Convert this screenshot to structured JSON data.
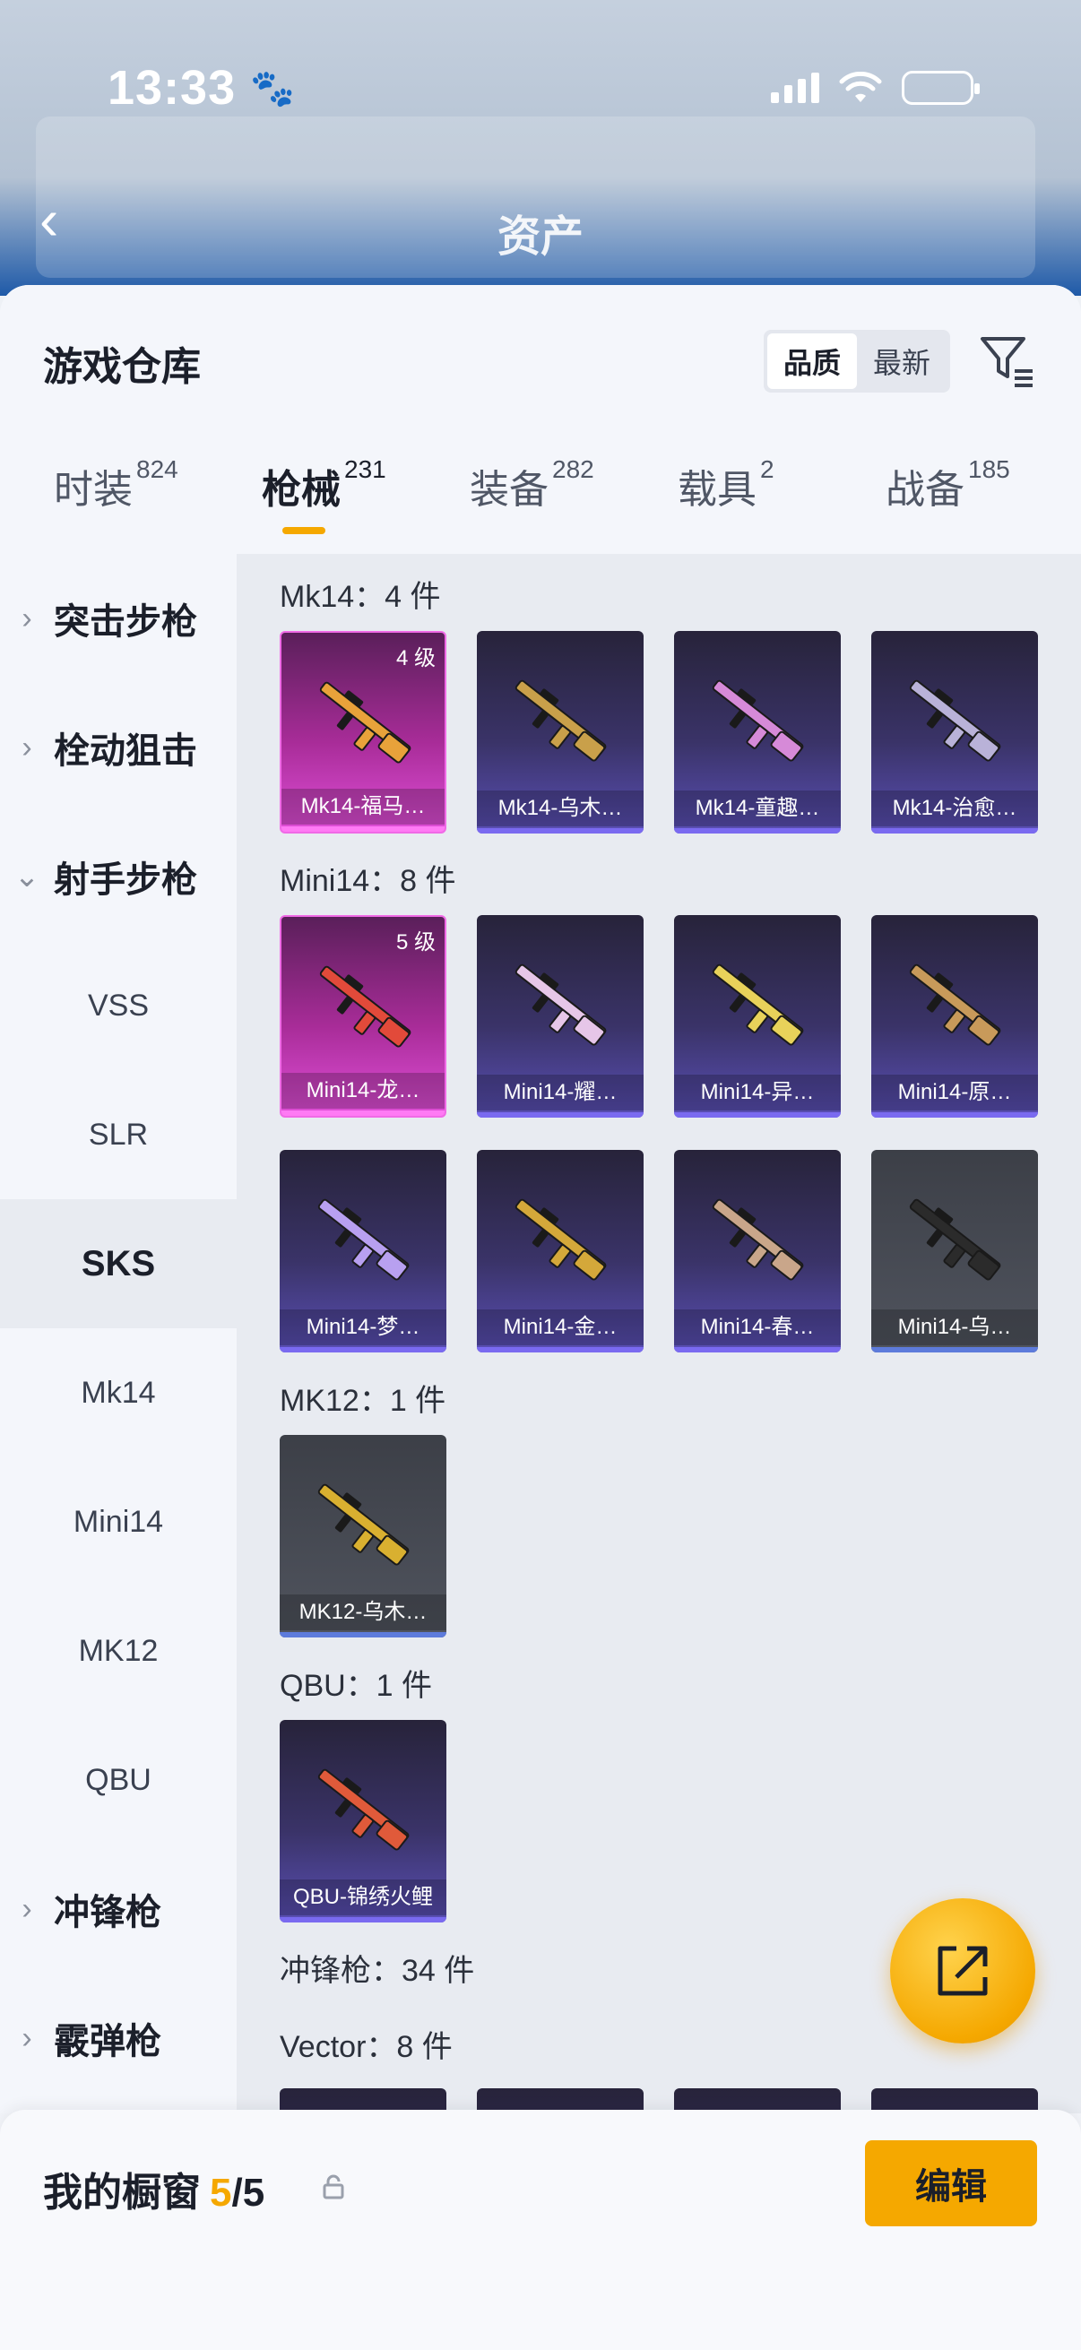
{
  "status_bar": {
    "time": "13:33"
  },
  "background": {
    "title": "资产"
  },
  "header": {
    "title": "游戏仓库",
    "sort_options": [
      "品质",
      "最新"
    ],
    "active_sort": 0
  },
  "tabs": [
    {
      "label": "时装",
      "count": "824"
    },
    {
      "label": "枪械",
      "count": "231"
    },
    {
      "label": "装备",
      "count": "282"
    },
    {
      "label": "载具",
      "count": "2"
    },
    {
      "label": "战备",
      "count": "185"
    }
  ],
  "sidebar": {
    "categories": [
      {
        "label": "突击步枪",
        "expanded": false
      },
      {
        "label": "栓动狙击",
        "expanded": false
      },
      {
        "label": "射手步枪",
        "expanded": true
      },
      {
        "label": "冲锋枪",
        "expanded": false
      },
      {
        "label": "霰弹枪",
        "expanded": false
      }
    ],
    "subcategories": [
      "VSS",
      "SLR",
      "SKS",
      "Mk14",
      "Mini14",
      "MK12",
      "QBU"
    ],
    "selected_sub": "SKS"
  },
  "groups": [
    {
      "title": "Mk14：4 件",
      "items": [
        {
          "name": "Mk14-福马…",
          "level": "4 级",
          "rarity": "pink"
        },
        {
          "name": "Mk14-乌木…",
          "rarity": "purple"
        },
        {
          "name": "Mk14-童趣…",
          "rarity": "purple"
        },
        {
          "name": "Mk14-治愈…",
          "rarity": "purple"
        }
      ]
    },
    {
      "title": "Mini14：8 件",
      "items": [
        {
          "name": "Mini14-龙…",
          "level": "5 级",
          "rarity": "pink"
        },
        {
          "name": "Mini14-耀…",
          "rarity": "purple"
        },
        {
          "name": "Mini14-异…",
          "rarity": "purple"
        },
        {
          "name": "Mini14-原…",
          "rarity": "purple"
        },
        {
          "name": "Mini14-梦…",
          "rarity": "purple"
        },
        {
          "name": "Mini14-金…",
          "rarity": "purple"
        },
        {
          "name": "Mini14-春…",
          "rarity": "purple"
        },
        {
          "name": "Mini14-乌…",
          "rarity": "gray"
        }
      ]
    },
    {
      "title": "MK12：1 件",
      "items": [
        {
          "name": "MK12-乌木…",
          "rarity": "gray"
        }
      ]
    },
    {
      "title": "QBU：1 件",
      "items": [
        {
          "name": "QBU-锦绣火鲤",
          "rarity": "purple"
        }
      ]
    },
    {
      "title": "冲锋枪：34 件",
      "items": []
    },
    {
      "title": "Vector：8 件",
      "items": []
    }
  ],
  "showcase": {
    "label": "我的橱窗",
    "current": "5",
    "separator": "/",
    "total": "5",
    "edit_label": "编辑"
  },
  "colors": {
    "accent": "#f5a800",
    "pink_rarity": "#e04fd8",
    "purple_rarity": "#5a4fb5",
    "gray_rarity": "#50545e"
  }
}
